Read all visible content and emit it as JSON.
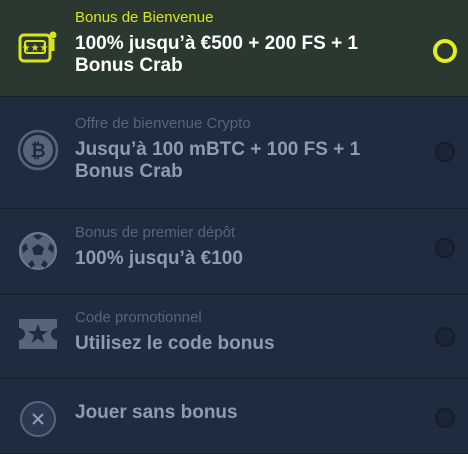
{
  "bonus_options": [
    {
      "label": "Bonus de Bienvenue",
      "title": "100% jusqu’à €500 + 200 FS + 1 Bonus Crab",
      "icon": "slot-machine-icon",
      "selected": true
    },
    {
      "label": "Offre de bienvenue Crypto",
      "title": "Jusqu’à 100 mBTC + 100 FS + 1 Bonus Crab",
      "icon": "bitcoin-icon",
      "selected": false
    },
    {
      "label": "Bonus de premier dépôt",
      "title": "100% jusqu’à €100",
      "icon": "soccer-ball-icon",
      "selected": false
    },
    {
      "label": "Code promotionnel",
      "title": "Utilisez le code bonus",
      "icon": "star-ticket-icon",
      "selected": false
    },
    {
      "label": "",
      "title": "Jouer sans bonus",
      "icon": "close-icon",
      "selected": false
    }
  ],
  "colors": {
    "accent": "#e3ee1e",
    "background": "#1e2a3d",
    "selected_background": "#2a3830"
  }
}
